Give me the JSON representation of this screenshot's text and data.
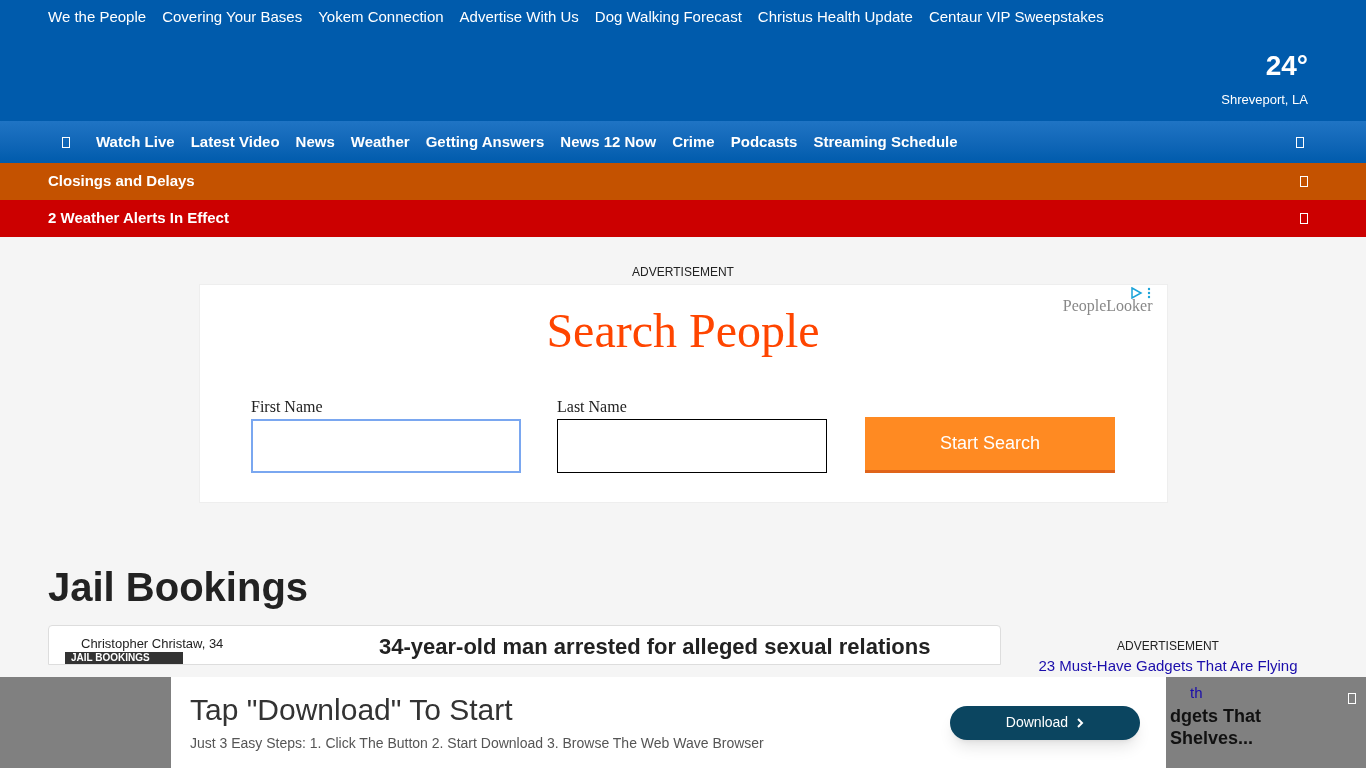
{
  "top_links": [
    "We the People",
    "Covering Your Bases",
    "Yokem Connection",
    "Advertise With Us",
    "Dog Walking Forecast",
    "Christus Health Update",
    "Centaur VIP Sweepstakes"
  ],
  "weather": {
    "temperature": "24°",
    "location": "Shreveport, LA"
  },
  "nav": {
    "items": [
      "Watch Live",
      "Latest Video",
      "News",
      "Weather",
      "Getting Answers",
      "News 12 Now",
      "Crime",
      "Podcasts",
      "Streaming Schedule"
    ]
  },
  "banners": [
    {
      "text": "Closings and Delays",
      "color": "#c45200"
    },
    {
      "text": "2 Weather Alerts In Effect",
      "color": "#cc0000"
    }
  ],
  "ad": {
    "label": "ADVERTISEMENT",
    "brand": "PeopleLooker",
    "title": "Search People",
    "fields": [
      {
        "label": "First Name",
        "focused": true
      },
      {
        "label": "Last Name",
        "focused": false
      }
    ],
    "button": "Start Search"
  },
  "section": {
    "title": "Jail Bookings",
    "card": {
      "image_alt": "Christopher Christaw, 34",
      "tag": "JAIL BOOKINGS",
      "headline": "34-year-old man arrested for alleged sexual relations"
    }
  },
  "side_ad": {
    "label": "ADVERTISEMENT",
    "link": "23 Must-Have Gadgets That Are Flying",
    "link_rest": "th",
    "title_lines": [
      "dgets That",
      "Shelves..."
    ]
  },
  "bottom_ad": {
    "title": "Tap \"Download\" To Start",
    "text": "Just 3 Easy Steps: 1. Click The Button 2. Start Download 3. Browse The Web Wave Browser",
    "button": "Download"
  }
}
